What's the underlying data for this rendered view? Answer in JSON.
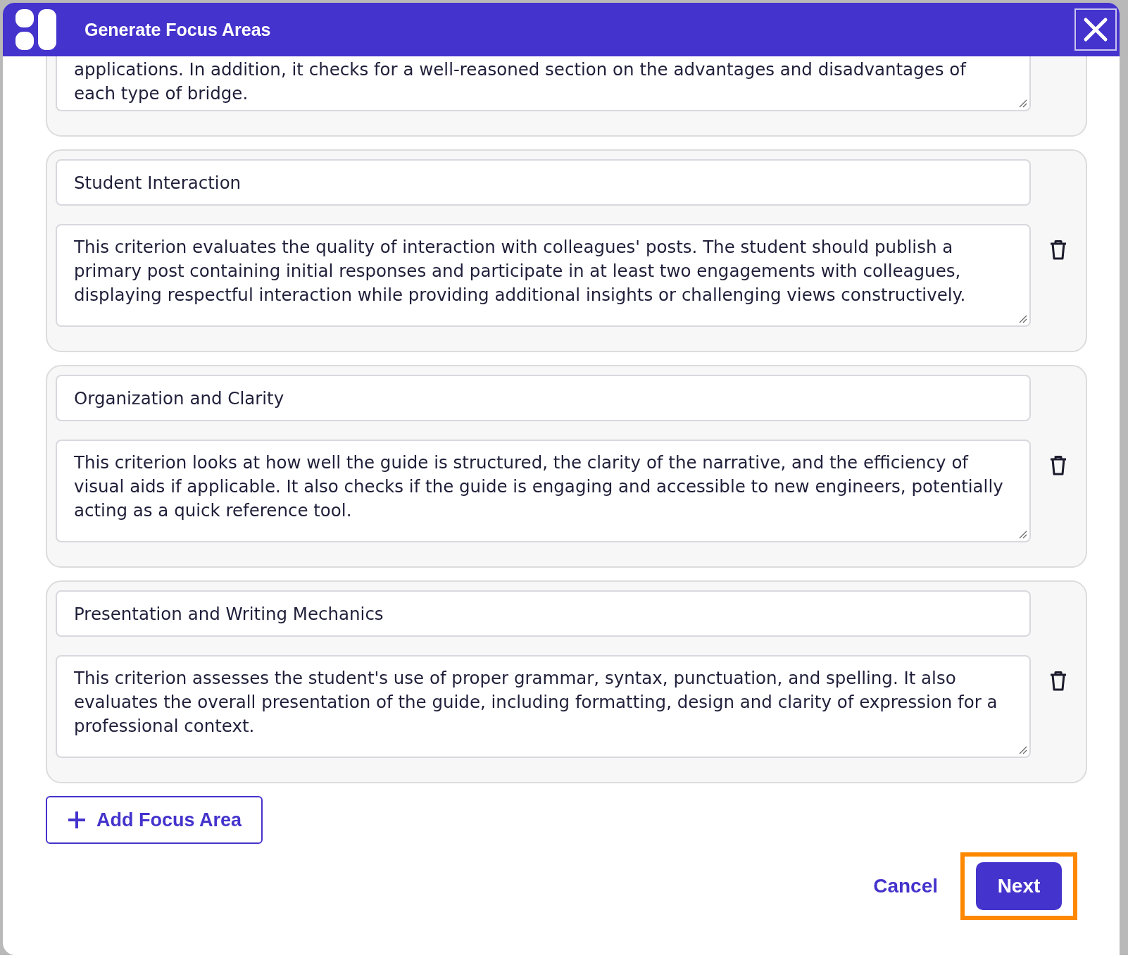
{
  "dialog": {
    "title": "Generate Focus Areas"
  },
  "partial_area": {
    "description": "applications. In addition, it checks for a well-reasoned section on the advantages and disadvantages of each type of bridge."
  },
  "focus_areas": [
    {
      "title": "Student Interaction",
      "description": "This criterion evaluates the quality of interaction with colleagues' posts. The student should publish a primary post containing initial responses and participate in at least two engagements with colleagues, displaying respectful interaction while providing additional insights or challenging views constructively."
    },
    {
      "title": "Organization and Clarity",
      "description": "This criterion looks at how well the guide is structured, the clarity of the narrative, and the efficiency of visual aids if applicable. It also checks if the guide is engaging and accessible to new engineers, potentially acting as a quick reference tool."
    },
    {
      "title": "Presentation and Writing Mechanics",
      "description": "This criterion assesses the student's use of proper grammar, syntax, punctuation, and spelling. It also evaluates the overall presentation of the guide, including formatting, design and clarity of expression for a professional context."
    }
  ],
  "add_button": {
    "label": "Add Focus Area"
  },
  "footer": {
    "cancel": "Cancel",
    "next": {
      "label": "Next",
      "highlighted": true
    }
  }
}
